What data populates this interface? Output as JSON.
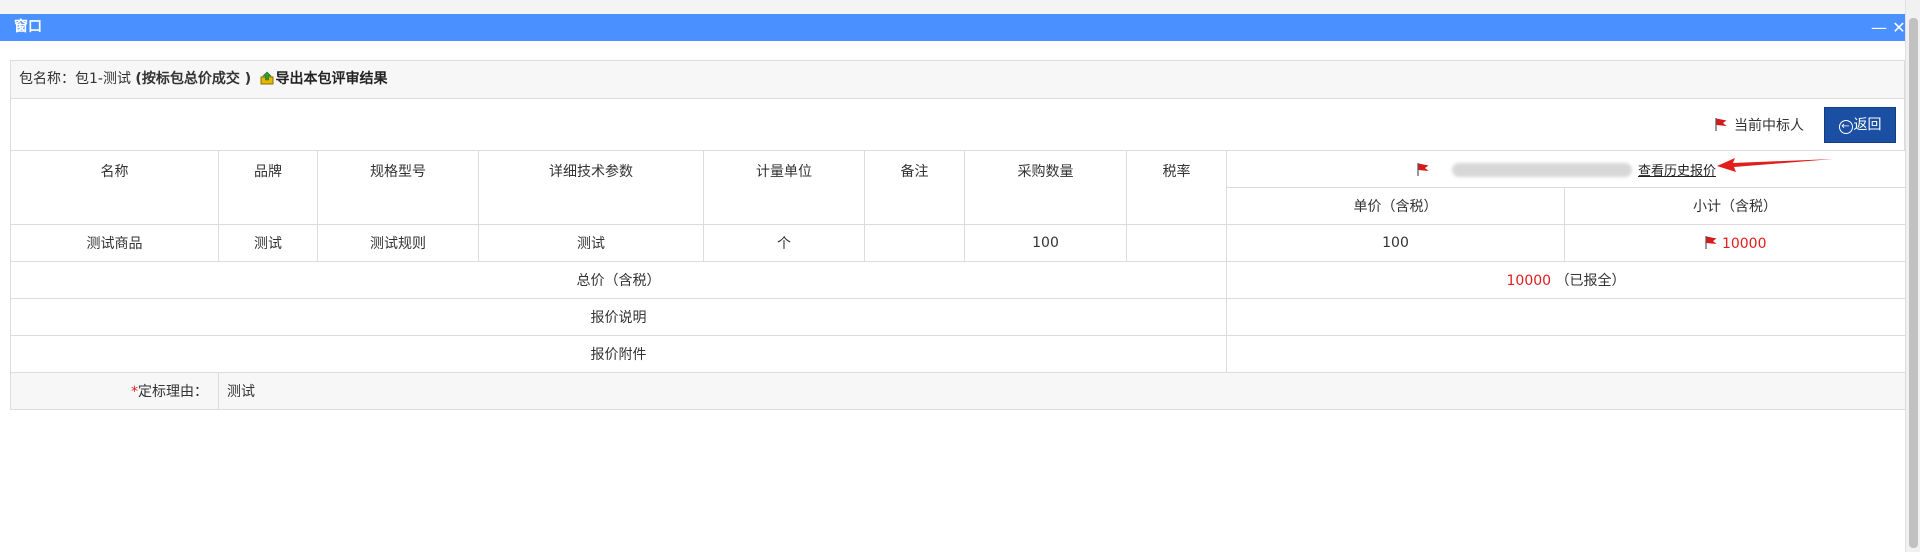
{
  "window": {
    "title": "窗口",
    "minimize_label": "—",
    "close_label": "✕"
  },
  "info": {
    "package_label": "包名称：包1-测试",
    "bid_mode": "(按标包总价成交 )",
    "export_label": "导出本包评审结果"
  },
  "actions": {
    "current_winner_label": "当前中标人",
    "back_label": "返回"
  },
  "table": {
    "headers": [
      "名称",
      "品牌",
      "规格型号",
      "详细技术参数",
      "计量单位",
      "备注",
      "采购数量",
      "税率"
    ],
    "supplier": {
      "history_link": "查看历史报价",
      "unit_price_header": "单价（含税）",
      "subtotal_header": "小计（含税）"
    },
    "rows": [
      {
        "name": "测试商品",
        "brand": "测试",
        "spec": "测试规则",
        "tech": "测试",
        "unit": "个",
        "remark": "",
        "qty": "100",
        "tax": "",
        "unit_price": "100",
        "subtotal": "10000"
      }
    ],
    "total_label": "总价（含税）",
    "total_value": "10000",
    "total_status": "（已报全）",
    "quote_note_label": "报价说明",
    "quote_attachment_label": "报价附件",
    "reason_label": "定标理由：",
    "reason_star": "*",
    "reason_value": "测试"
  },
  "colors": {
    "titlebar": "#4a90ff",
    "back_button": "#1a4fa3",
    "highlight_red": "#e31c1c",
    "flag_red": "#d41b1b"
  },
  "icons": {
    "flag": "red-flag-icon",
    "export": "export-icon",
    "back": "back-circle-arrow-icon",
    "arrow": "red-pointer-arrow"
  }
}
